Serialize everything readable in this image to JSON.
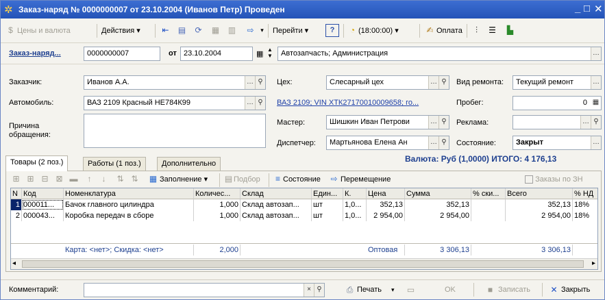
{
  "window": {
    "title": "Заказ-наряд № 0000000007 от 23.10.2004 (Иванов Петр) Проведен"
  },
  "toolbar": {
    "prices": "Цены и валюта",
    "actions": "Действия",
    "goto": "Перейти",
    "help": "?",
    "time": "(18:00:00)",
    "payment": "Оплата"
  },
  "header": {
    "doc_label": "Заказ-наряд...",
    "number": "0000000007",
    "date_label": "от",
    "date": "23.10.2004",
    "org": "Автозапчасть; Администрация"
  },
  "form": {
    "customer_label": "Заказчик:",
    "customer": "Иванов А.А.",
    "car_label": "Автомобиль:",
    "car": "ВАЗ 2109 Красный НЕ784К99",
    "reason_label": "Причина обращения:",
    "reason": "",
    "shop_label": "Цех:",
    "shop": "Слесарный цех",
    "car_link": "ВАЗ 2109; VIN ХТК27170010009658; го...",
    "master_label": "Мастер:",
    "master": "Шишкин Иван Петрови",
    "dispatcher_label": "Диспетчер:",
    "dispatcher": "Мартьянова Елена Ан",
    "repair_label": "Вид ремонта:",
    "repair": "Текущий ремонт",
    "mileage_label": "Пробег:",
    "mileage": "0",
    "ad_label": "Реклама:",
    "ad": "",
    "state_label": "Состояние:",
    "state": "Закрыт"
  },
  "totals": "Валюта: Руб (1,0000) ИТОГО: 4 176,13",
  "tabs": [
    {
      "label": "Товары (2 поз.)"
    },
    {
      "label": "Работы (1 поз.)"
    },
    {
      "label": "Дополнительно"
    }
  ],
  "grid_toolbar": {
    "fill": "Заполнение",
    "select": "Подбор",
    "state": "Состояние",
    "move": "Перемещение",
    "orders_check": "Заказы по ЗН"
  },
  "grid": {
    "columns": [
      "N",
      "Код",
      "Номенклатура",
      "Количес...",
      "Склад",
      "Един...",
      "К.",
      "Цена",
      "Сумма",
      "% ски...",
      "Всего",
      "% НД"
    ],
    "rows": [
      [
        "1",
        "000011...",
        "Бачок главного цилиндра",
        "1,000",
        "Склад автозап...",
        "шт",
        "1,0...",
        "352,13",
        "352,13",
        "",
        "352,13",
        "18%"
      ],
      [
        "2",
        "000043...",
        "Коробка передач в сборе",
        "1,000",
        "Склад автозап...",
        "шт",
        "1,0...",
        "2 954,00",
        "2 954,00",
        "",
        "2 954,00",
        "18%"
      ]
    ],
    "footer": {
      "card": "Карта: <нет>; Скидка: <нет>",
      "qty": "2,000",
      "price_type": "Оптовая",
      "sum": "3 306,13",
      "total": "3 306,13"
    }
  },
  "bottom": {
    "comment_label": "Комментарий:",
    "comment": "",
    "print": "Печать",
    "ok": "OK",
    "save": "Записать",
    "close": "Закрыть"
  },
  "colors": {
    "titlebar": "#2a5bc4",
    "link": "#1d3fa8",
    "total": "#1d3f8f"
  }
}
